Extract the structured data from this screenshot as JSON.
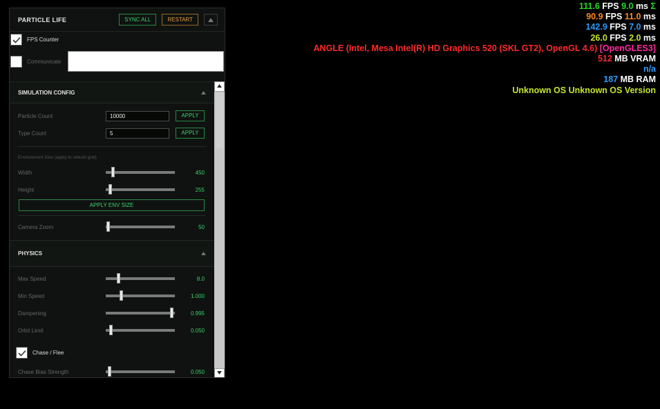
{
  "stats": [
    {
      "a": "111.6",
      "a_color": "#2ad62a",
      "b": " FPS ",
      "c": "9.0",
      "c_color": "#2ad62a",
      "d": " ms ",
      "e": "Σ",
      "e_color": "#2ad62a"
    },
    {
      "a": "90.9",
      "a_color": "#ff8a1e",
      "b": " FPS ",
      "c": "11.0",
      "c_color": "#ff8a1e",
      "d": " ms",
      "e": "",
      "e_color": "#fff"
    },
    {
      "a": "142.9",
      "a_color": "#2a9dff",
      "b": " FPS ",
      "c": "7.0",
      "c_color": "#2a9dff",
      "d": " ms",
      "e": "",
      "e_color": "#fff"
    },
    {
      "a": "26.0",
      "a_color": "#c8e42a",
      "b": " FPS ",
      "c": "2.0",
      "c_color": "#c8e42a",
      "d": " ms",
      "e": "",
      "e_color": "#fff"
    }
  ],
  "gpu": {
    "text": "ANGLE (Intel, Mesa Intel(R) HD Graphics 520 (SKL GT2), OpenGL 4.6) ",
    "color": "#ff2a2a",
    "tag": "[OpenGLES3]",
    "tag_color": "#ff2aa0"
  },
  "vram": {
    "value": "512",
    "value_color": "#ff2a2a",
    "unit": " MB VRAM"
  },
  "na": {
    "text": "n/a",
    "color": "#2a9dff"
  },
  "ram": {
    "value": "187",
    "value_color": "#2a9dff",
    "unit": " MB RAM"
  },
  "os": {
    "text": "Unknown OS Unknown OS Version",
    "color": "#c8e42a"
  },
  "panel": {
    "title": "PARTICLE LIFE",
    "sync_label": "SYNC ALL",
    "restart_label": "RESTART",
    "fps_counter_label": "FPS Counter",
    "communicate_label": "Communicate"
  },
  "sim": {
    "title": "SIMULATION CONFIG",
    "particle_count_label": "Particle Count",
    "particle_count_value": "10000",
    "type_count_label": "Type Count",
    "type_count_value": "5",
    "apply_label": "APPLY",
    "env_hint": "Environment Size  (apply to rebuild grid)",
    "width_label": "Width",
    "width_value": "450",
    "width_pos": 0.1,
    "height_label": "Height",
    "height_value": "255",
    "height_pos": 0.06,
    "apply_env_label": "APPLY ENV SIZE",
    "zoom_label": "Camera Zoom",
    "zoom_value": "50",
    "zoom_pos": 0.03
  },
  "physics": {
    "title": "PHYSICS",
    "max_speed_label": "Max Speed",
    "max_speed_value": "8.0",
    "max_speed_pos": 0.18,
    "min_speed_label": "Min Speed",
    "min_speed_value": "1.000",
    "min_speed_pos": 0.22,
    "dampening_label": "Dampening",
    "dampening_value": "0.995",
    "dampening_pos": 0.95,
    "orbit_label": "Orbit Limit",
    "orbit_value": "0.050",
    "orbit_pos": 0.07,
    "chase_label": "Chase / Flee",
    "chase_bias_label": "Chase Bias Strength",
    "chase_bias_value": "0.050",
    "chase_bias_pos": 0.05
  }
}
